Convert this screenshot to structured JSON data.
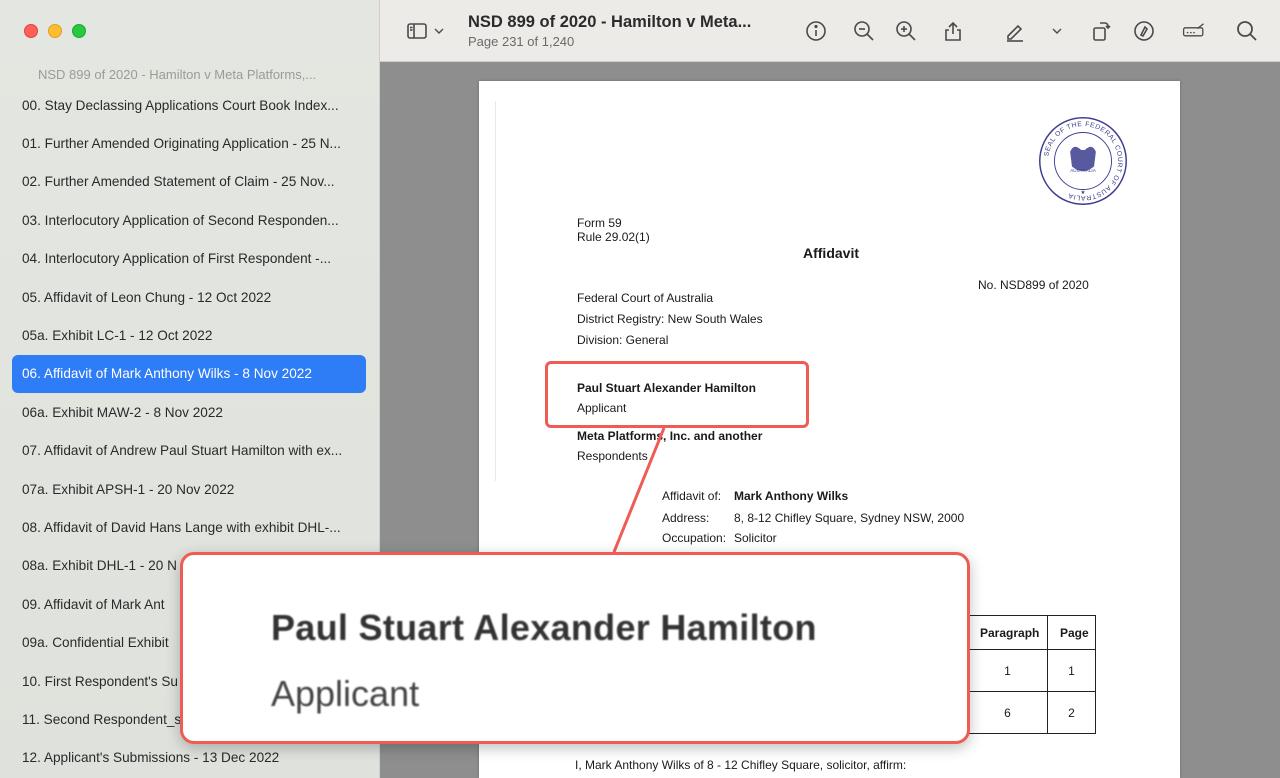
{
  "window": {
    "title": "NSD 899 of 2020 - Hamilton v Meta...",
    "page_indicator": "Page 231 of 1,240"
  },
  "sidebar": {
    "header": "NSD 899 of 2020 - Hamilton v Meta Platforms,...",
    "items": [
      {
        "label": "00. Stay Declassing Applications Court Book Index..."
      },
      {
        "label": "01. Further Amended Originating Application - 25 N..."
      },
      {
        "label": "02. Further Amended Statement of Claim - 25 Nov..."
      },
      {
        "label": "03. Interlocutory Application of Second Responden..."
      },
      {
        "label": "04. Interlocutory Application of First Respondent -..."
      },
      {
        "label": "05. Affidavit of Leon Chung - 12 Oct 2022"
      },
      {
        "label": "05a. Exhibit LC-1 - 12 Oct 2022"
      },
      {
        "label": "06. Affidavit of Mark Anthony Wilks - 8 Nov 2022",
        "active": true
      },
      {
        "label": "06a. Exhibit MAW-2 - 8 Nov 2022"
      },
      {
        "label": "07. Affidavit of Andrew Paul Stuart Hamilton with ex..."
      },
      {
        "label": "07a. Exhibit APSH-1 - 20 Nov 2022"
      },
      {
        "label": "08. Affidavit of David Hans Lange with exhibit DHL-..."
      },
      {
        "label": "08a. Exhibit DHL-1 - 20 N"
      },
      {
        "label": "09.  Affidavit of Mark Ant"
      },
      {
        "label": "09a. Confidential Exhibit"
      },
      {
        "label": "10. First Respondent's Su"
      },
      {
        "label": "11. Second Respondent_s"
      },
      {
        "label": "12. Applicant's Submissions - 13 Dec 2022"
      }
    ]
  },
  "toolbar": {
    "icons": [
      "sidebar-icon",
      "chevron-down-icon",
      "info-icon",
      "zoom-out-icon",
      "zoom-in-icon",
      "share-icon",
      "highlight-icon",
      "chevron-down-icon",
      "rotate-icon",
      "markup-icon",
      "signature-icon",
      "search-icon"
    ]
  },
  "document": {
    "form_no": "Form 59",
    "rule": "Rule 29.02(1)",
    "heading": "Affidavit",
    "case_no": "No. NSD899 of 2020",
    "court": "Federal Court of Australia",
    "registry": "District Registry: New South Wales",
    "division": "Division: General",
    "applicant_name": "Paul Stuart Alexander Hamilton",
    "applicant_role": "Applicant",
    "respondent_name": "Meta Platforms, Inc. and another",
    "respondent_role": "Respondents",
    "affidavit_of_label": "Affidavit of:",
    "affidavit_of_value": "Mark Anthony Wilks",
    "address_label": "Address:",
    "address_value": "8, 8-12 Chifley Square, Sydney NSW, 2000",
    "occupation_label": "Occupation:",
    "occupation_value": "Solicitor",
    "table_headers": [
      "Paragraph",
      "Page"
    ],
    "table_rows": [
      [
        "1",
        "1"
      ],
      [
        "6",
        "2"
      ]
    ],
    "affirm_text": "I, Mark Anthony Wilks of 8 - 12 Chifley Square, solicitor, affirm:",
    "seal_text": "SEAL OF THE FEDERAL COURT OF AUSTRALIA",
    "seal_center": "AUSTRALIA"
  },
  "callout": {
    "name": "Paul Stuart Alexander Hamilton",
    "role": "Applicant",
    "color": "#ef5b55"
  }
}
